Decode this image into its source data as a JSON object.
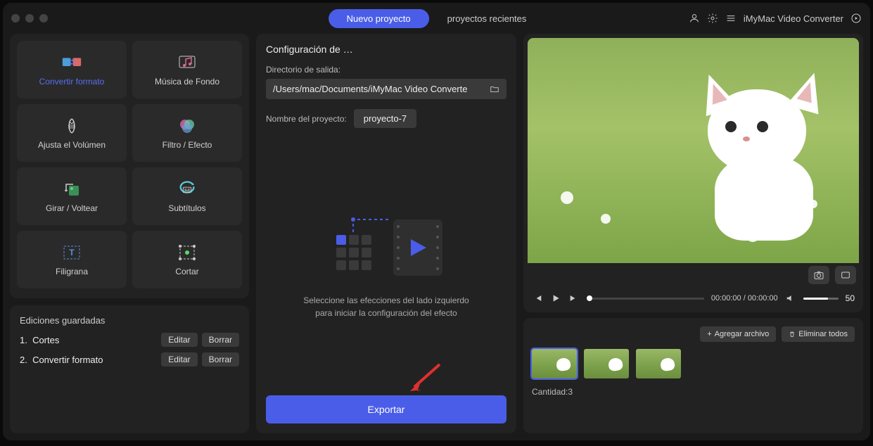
{
  "header": {
    "tab_new": "Nuevo proyecto",
    "tab_recent": "proyectos recientes",
    "app_title": "iMyMac Video Converter"
  },
  "tools": [
    {
      "label": "Convertir formato",
      "active": true,
      "icon": "convert"
    },
    {
      "label": "Música de Fondo",
      "active": false,
      "icon": "music"
    },
    {
      "label": "Ajusta el Volúmen",
      "active": false,
      "icon": "volume"
    },
    {
      "label": "Filtro / Efecto",
      "active": false,
      "icon": "filter"
    },
    {
      "label": "Girar / Voltear",
      "active": false,
      "icon": "rotate"
    },
    {
      "label": "Subtítulos",
      "active": false,
      "icon": "subtitle"
    },
    {
      "label": "Filigrana",
      "active": false,
      "icon": "watermark"
    },
    {
      "label": "Cortar",
      "active": false,
      "icon": "crop"
    }
  ],
  "saved": {
    "title": "Ediciones guardadas",
    "rows": [
      {
        "idx": "1.",
        "name": "Cortes"
      },
      {
        "idx": "2.",
        "name": "Convertir formato"
      }
    ],
    "edit": "Editar",
    "delete": "Borrar"
  },
  "config": {
    "title": "Configuración de …",
    "dir_label": "Directorio de salida:",
    "dir_value": "/Users/mac/Documents/iMyMac Video Converte",
    "name_label": "Nombre del proyecto:",
    "name_value": "proyecto-7",
    "hint1": "Seleccione las efecciones del lado izquierdo",
    "hint2": "para iniciar la configuración del efecto",
    "export": "Exportar"
  },
  "player": {
    "time": "00:00:00 / 00:00:00",
    "volume": "50"
  },
  "files": {
    "add": "Agregar archivo",
    "remove_all": "Eliminar todos",
    "count_label": "Cantidad:3"
  }
}
